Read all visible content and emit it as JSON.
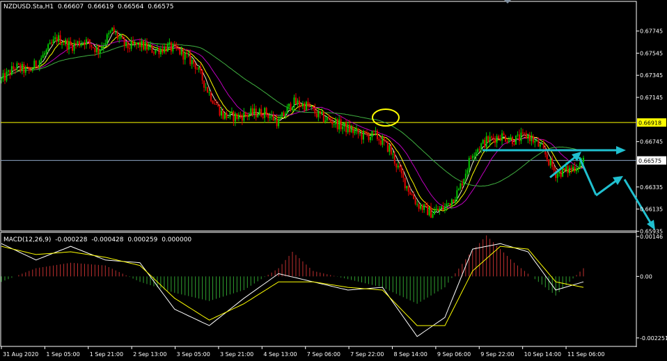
{
  "price_panel": {
    "symbol": "NZDUSD.Sta",
    "timeframe": "H1",
    "open": "0.66607",
    "high": "0.66619",
    "low": "0.66564",
    "close": "0.66575"
  },
  "macd_panel": {
    "label": "MACD(12,26,9)",
    "v1": "-0.000228",
    "v2": "-0.000428",
    "v3": "0.000259",
    "v4": "0.000000"
  },
  "colors": {
    "background": "#000000",
    "frame": "#ffffff",
    "bull": "#00c800",
    "bear": "#e00000",
    "ma_fast": "#e8e8c0",
    "ma_mid": "#ffff00",
    "ma_slow": "#c000c0",
    "ma_long": "#40b040",
    "hline_yellow": "#ffff00",
    "hline_blue": "#8fa8c8",
    "arrow": "#20c0d0",
    "macd_hist_pos": "#c03030",
    "macd_hist_neg": "#30a030",
    "macd_main": "#ffffff",
    "macd_signal": "#ffff00"
  },
  "chart_data": [
    {
      "type": "candlestick",
      "title": "NZDUSD.Sta,H1",
      "ylim": [
        0.6595,
        0.679
      ],
      "y_ticks": [
        "0.67745",
        "0.67545",
        "0.67345",
        "0.67145",
        "0.66745",
        "0.66335",
        "0.66135",
        "0.65935"
      ],
      "x_ticks": [
        "31 Aug 2020",
        "1 Sep 05:00",
        "1 Sep 21:00",
        "2 Sep 13:00",
        "3 Sep 05:00",
        "3 Sep 21:00",
        "4 Sep 13:00",
        "7 Sep 06:00",
        "7 Sep 22:00",
        "8 Sep 14:00",
        "9 Sep 06:00",
        "9 Sep 22:00",
        "10 Sep 14:00",
        "11 Sep 06:00"
      ],
      "key_levels": [
        {
          "value": 0.66918,
          "label": "0.66918",
          "color": "#ffff00"
        },
        {
          "value": 0.66575,
          "label": "0.66575",
          "color": "#8fa8c8"
        }
      ],
      "price_path": [
        [
          0,
          0.673
        ],
        [
          8,
          0.6742
        ],
        [
          16,
          0.6738
        ],
        [
          24,
          0.6752
        ],
        [
          32,
          0.6768
        ],
        [
          40,
          0.6761
        ],
        [
          48,
          0.6766
        ],
        [
          56,
          0.6757
        ],
        [
          64,
          0.6775
        ],
        [
          72,
          0.676
        ],
        [
          80,
          0.6762
        ],
        [
          88,
          0.6757
        ],
        [
          96,
          0.676
        ],
        [
          104,
          0.6755
        ],
        [
          112,
          0.6744
        ],
        [
          120,
          0.6718
        ],
        [
          128,
          0.6698
        ],
        [
          136,
          0.6697
        ],
        [
          144,
          0.67
        ],
        [
          152,
          0.6701
        ],
        [
          160,
          0.6692
        ],
        [
          168,
          0.671
        ],
        [
          176,
          0.6707
        ],
        [
          184,
          0.6697
        ],
        [
          192,
          0.6692
        ],
        [
          200,
          0.6686
        ],
        [
          208,
          0.668
        ],
        [
          216,
          0.668
        ],
        [
          224,
          0.6668
        ],
        [
          232,
          0.664
        ],
        [
          240,
          0.6618
        ],
        [
          248,
          0.661
        ],
        [
          256,
          0.6615
        ],
        [
          264,
          0.663
        ],
        [
          272,
          0.6665
        ],
        [
          280,
          0.6675
        ],
        [
          288,
          0.668
        ],
        [
          296,
          0.6676
        ],
        [
          304,
          0.668
        ],
        [
          312,
          0.6668
        ],
        [
          320,
          0.6646
        ],
        [
          328,
          0.6649
        ],
        [
          336,
          0.6657
        ]
      ]
    },
    {
      "type": "macd",
      "title": "MACD(12,26,9)",
      "ylim": [
        -0.00251,
        0.00146
      ],
      "y_ticks": [
        "0.00146",
        "0.00",
        "-0.002251"
      ],
      "histogram": [
        [
          0,
          -0.0002
        ],
        [
          20,
          0.0003
        ],
        [
          40,
          0.0005
        ],
        [
          60,
          0.0004
        ],
        [
          80,
          -0.0002
        ],
        [
          100,
          -0.0006
        ],
        [
          120,
          -0.0009
        ],
        [
          140,
          -0.0005
        ],
        [
          160,
          0.0003
        ],
        [
          168,
          0.0009
        ],
        [
          180,
          0.0002
        ],
        [
          200,
          -0.0001
        ],
        [
          220,
          -0.0004
        ],
        [
          240,
          -0.001
        ],
        [
          256,
          -0.0004
        ],
        [
          270,
          0.0008
        ],
        [
          280,
          0.0015
        ],
        [
          296,
          0.0005
        ],
        [
          312,
          -0.0003
        ],
        [
          320,
          -0.0007
        ],
        [
          336,
          0.0003
        ]
      ],
      "main": [
        [
          0,
          0.0012
        ],
        [
          20,
          0.0006
        ],
        [
          40,
          0.0011
        ],
        [
          60,
          0.0006
        ],
        [
          80,
          0.0005
        ],
        [
          100,
          -0.0012
        ],
        [
          120,
          -0.0018
        ],
        [
          140,
          -0.0008
        ],
        [
          160,
          0.0001
        ],
        [
          180,
          -0.0002
        ],
        [
          200,
          -0.0005
        ],
        [
          220,
          -0.0004
        ],
        [
          240,
          -0.0022
        ],
        [
          256,
          -0.0015
        ],
        [
          272,
          0.001
        ],
        [
          288,
          0.0012
        ],
        [
          304,
          0.0009
        ],
        [
          320,
          -0.0005
        ],
        [
          336,
          -0.0002
        ]
      ],
      "signal": [
        [
          0,
          0.0011
        ],
        [
          20,
          0.0008
        ],
        [
          40,
          0.0009
        ],
        [
          60,
          0.0007
        ],
        [
          80,
          0.0004
        ],
        [
          100,
          -0.0008
        ],
        [
          120,
          -0.0016
        ],
        [
          140,
          -0.001
        ],
        [
          160,
          -0.0002
        ],
        [
          180,
          -0.0002
        ],
        [
          200,
          -0.0004
        ],
        [
          220,
          -0.0005
        ],
        [
          240,
          -0.0018
        ],
        [
          256,
          -0.0018
        ],
        [
          272,
          0.0002
        ],
        [
          288,
          0.0011
        ],
        [
          304,
          0.001
        ],
        [
          320,
          -0.0002
        ],
        [
          336,
          -0.0004
        ]
      ]
    }
  ]
}
